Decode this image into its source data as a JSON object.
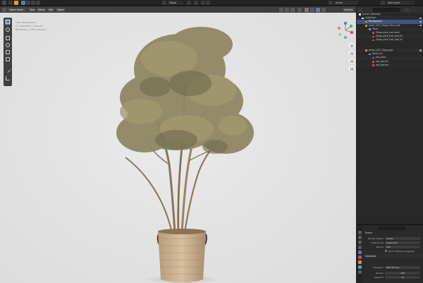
{
  "topbar": {
    "scene_label": "Scene",
    "view_layer_label": "View Layer",
    "mode": "Object Mode",
    "menus": [
      "View",
      "Select",
      "Add",
      "Object"
    ],
    "transform_orientation": "Global",
    "options_label": "Options"
  },
  "viewport": {
    "info_lines": [
      "User Perspective",
      "(1) Collection | Sample",
      "Rendering 1/256 samples"
    ]
  },
  "outliner": {
    "search_placeholder": "",
    "items": [
      {
        "label": "Scene Collection",
        "kind": "collection",
        "depth": 0
      },
      {
        "label": "Collection",
        "kind": "collection",
        "depth": 1
      },
      {
        "label": "Background",
        "kind": "object",
        "depth": 2,
        "selected": true
      },
      {
        "label": "plant_1107_Ziaga_Olive_tree",
        "kind": "object",
        "depth": 2
      },
      {
        "label": "Plant",
        "kind": "mesh",
        "depth": 3
      },
      {
        "label": "Ziaga_olive_tree_bark",
        "kind": "material",
        "depth": 4
      },
      {
        "label": "Ziaga_olive_tree_leaf_01",
        "kind": "material",
        "depth": 4
      },
      {
        "label": "Ziaga_olive_tree_leaf_02",
        "kind": "material",
        "depth": 4
      },
      {
        "label": "plant_1107_Ziaga_pot",
        "kind": "object",
        "depth": 2
      },
      {
        "label": "Mesh.011",
        "kind": "mesh",
        "depth": 3
      },
      {
        "label": "pot_color",
        "kind": "material",
        "depth": 4
      },
      {
        "label": "pot_ground",
        "kind": "material",
        "depth": 4
      },
      {
        "label": "pot_texture",
        "kind": "material",
        "depth": 4
      }
    ]
  },
  "properties": {
    "section": "Scene",
    "rows": [
      {
        "label": "Render Engine",
        "value": "Cycles"
      },
      {
        "label": "Feature Set",
        "value": "Supported"
      },
      {
        "label": "Device",
        "value": "CPU"
      }
    ],
    "osl_label": "Open Shading Language",
    "sampling_label": "Sampling",
    "integrator_label": "Integrator",
    "integrator_value": "Path Tracing",
    "render_label": "Render",
    "render_value": "128",
    "viewport_label": "Viewport",
    "viewport_value": "32"
  },
  "colors": {
    "selection": "#3c5680",
    "object_icon": "#e08a3c",
    "mesh_icon": "#3ea6d6",
    "material_icon": "#d25252",
    "collection_icon": "#e6e6e6"
  }
}
